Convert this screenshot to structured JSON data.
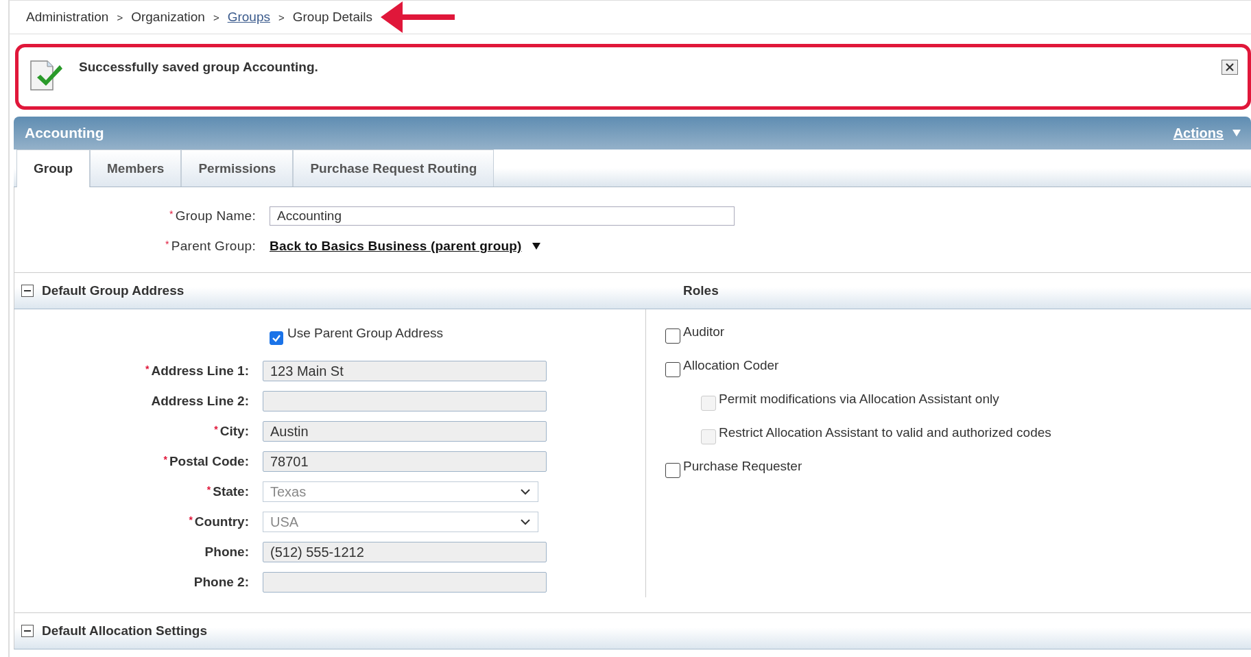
{
  "breadcrumb": [
    {
      "label": "Administration",
      "link": false
    },
    {
      "label": "Organization",
      "link": false
    },
    {
      "label": "Groups",
      "link": true
    },
    {
      "label": "Group Details",
      "link": false
    }
  ],
  "breadcrumb_separator": ">",
  "annotation_arrow": true,
  "required_mark": "*",
  "alert": {
    "message": "Successfully saved group Accounting.",
    "highlighted": true
  },
  "panel": {
    "title": "Accounting",
    "actions": "Actions"
  },
  "tabs": [
    {
      "label": "Group",
      "selected": true
    },
    {
      "label": "Members",
      "selected": false
    },
    {
      "label": "Permissions",
      "selected": false
    },
    {
      "label": "Purchase Request Routing",
      "selected": false
    }
  ],
  "group_name": {
    "label": "Group Name:",
    "required": true,
    "value": "Accounting"
  },
  "parent_group": {
    "label": "Parent Group:",
    "required": true,
    "value": "Back to Basics Business (parent group)"
  },
  "address_section": {
    "title": "Default Group Address",
    "expanded": true
  },
  "roles_title": "Roles",
  "use_parent": {
    "label": "Use Parent Group Address",
    "checked": true
  },
  "address_fields": [
    {
      "label": "Address Line 1:",
      "required": true,
      "kind": "text",
      "value": "123 Main St"
    },
    {
      "label": "Address Line 2:",
      "required": false,
      "kind": "text"
    },
    {
      "label": "City:",
      "required": true,
      "kind": "text",
      "value": "Austin"
    },
    {
      "label": "Postal Code:",
      "required": true,
      "kind": "text",
      "value": "78701"
    },
    {
      "label": "State:",
      "required": true,
      "kind": "select",
      "value": "Texas"
    },
    {
      "label": "Country:",
      "required": true,
      "kind": "select",
      "value": "USA"
    },
    {
      "label": "Phone:",
      "required": false,
      "kind": "text",
      "value": "(512) 555-1212"
    },
    {
      "label": "Phone 2:",
      "required": false,
      "kind": "text"
    }
  ],
  "roles": [
    {
      "label": "Auditor",
      "checked": false,
      "disabled": false
    },
    {
      "label": "Allocation Coder",
      "checked": false,
      "disabled": false,
      "children": [
        {
          "label": "Permit modifications via Allocation Assistant only",
          "checked": false,
          "disabled": true
        },
        {
          "label": "Restrict Allocation Assistant to valid and authorized codes",
          "checked": false,
          "disabled": true
        }
      ]
    },
    {
      "label": "Purchase Requester",
      "checked": false,
      "disabled": false
    }
  ],
  "allocation_section": {
    "title": "Default Allocation Settings",
    "expanded": true
  }
}
